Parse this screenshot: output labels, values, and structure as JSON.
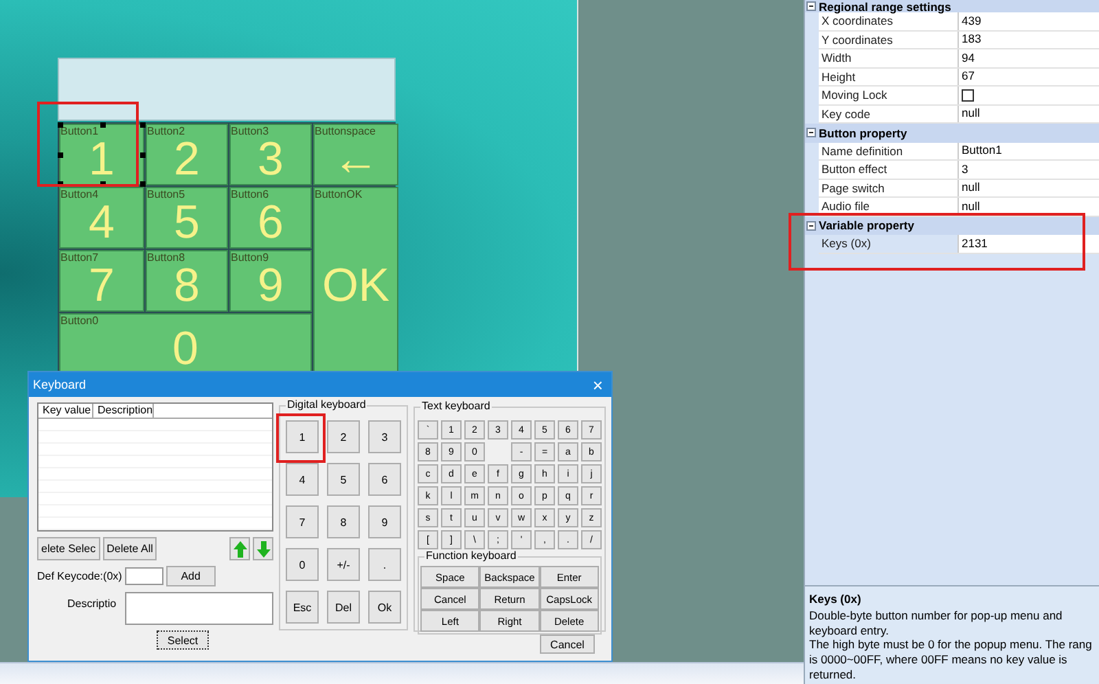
{
  "keypad": {
    "buttons": [
      {
        "name": "Button1",
        "label": "1",
        "selected": true
      },
      {
        "name": "Button2",
        "label": "2",
        "selected": false
      },
      {
        "name": "Button3",
        "label": "3",
        "selected": false
      },
      {
        "name": "Buttonspace",
        "label": "←",
        "selected": false
      },
      {
        "name": "Button4",
        "label": "4",
        "selected": false
      },
      {
        "name": "Button5",
        "label": "5",
        "selected": false
      },
      {
        "name": "Button6",
        "label": "6",
        "selected": false
      },
      {
        "name": "Button7",
        "label": "7",
        "selected": false
      },
      {
        "name": "Button8",
        "label": "8",
        "selected": false
      },
      {
        "name": "Button9",
        "label": "9",
        "selected": false
      },
      {
        "name": "ButtonOK",
        "label": "OK",
        "selected": false
      },
      {
        "name": "Button0",
        "label": "0",
        "selected": false
      }
    ]
  },
  "dialog": {
    "title": "Keyboard",
    "close": "×",
    "list": {
      "columns": [
        "Key value",
        "Description"
      ]
    },
    "buttons": [
      "elete Selec",
      "Delete All"
    ],
    "keycode_label": "Def  Keycode:(0x)",
    "add": "Add",
    "description_label": "Descriptio",
    "select": "Select",
    "cancel": "Cancel",
    "digital": {
      "title": "Digital keyboard",
      "keys": [
        {
          "label": "1",
          "highlighted": true
        },
        {
          "label": "2",
          "highlighted": false
        },
        {
          "label": "3",
          "highlighted": false
        },
        {
          "label": "4",
          "highlighted": false
        },
        {
          "label": "5",
          "highlighted": false
        },
        {
          "label": "6",
          "highlighted": false
        },
        {
          "label": "7",
          "highlighted": false
        },
        {
          "label": "8",
          "highlighted": false
        },
        {
          "label": "9",
          "highlighted": false
        },
        {
          "label": "0",
          "highlighted": false
        },
        {
          "label": "+/-",
          "highlighted": false
        },
        {
          "label": ".",
          "highlighted": false
        },
        {
          "label": "Esc",
          "highlighted": false
        },
        {
          "label": "Del",
          "highlighted": false
        },
        {
          "label": "Ok",
          "highlighted": false
        }
      ]
    },
    "text": {
      "title": "Text keyboard",
      "keys": [
        {
          "kind": "key",
          "label": "`"
        },
        {
          "kind": "key",
          "label": "1"
        },
        {
          "kind": "key",
          "label": "2"
        },
        {
          "kind": "key",
          "label": "3"
        },
        {
          "kind": "key",
          "label": "4"
        },
        {
          "kind": "key",
          "label": "5"
        },
        {
          "kind": "key",
          "label": "6"
        },
        {
          "kind": "key",
          "label": "7"
        },
        {
          "kind": "key",
          "label": "8"
        },
        {
          "kind": "key",
          "label": "9"
        },
        {
          "kind": "key",
          "label": "0"
        },
        {
          "kind": "gap"
        },
        {
          "kind": "key",
          "label": "-"
        },
        {
          "kind": "key",
          "label": "="
        },
        {
          "kind": "key",
          "label": "a"
        },
        {
          "kind": "key",
          "label": "b"
        },
        {
          "kind": "key",
          "label": "c"
        },
        {
          "kind": "key",
          "label": "d"
        },
        {
          "kind": "key",
          "label": "e"
        },
        {
          "kind": "key",
          "label": "f"
        },
        {
          "kind": "key",
          "label": "g"
        },
        {
          "kind": "key",
          "label": "h"
        },
        {
          "kind": "key",
          "label": "i"
        },
        {
          "kind": "key",
          "label": "j"
        },
        {
          "kind": "key",
          "label": "k"
        },
        {
          "kind": "key",
          "label": "l"
        },
        {
          "kind": "key",
          "label": "m"
        },
        {
          "kind": "key",
          "label": "n"
        },
        {
          "kind": "key",
          "label": "o"
        },
        {
          "kind": "key",
          "label": "p"
        },
        {
          "kind": "key",
          "label": "q"
        },
        {
          "kind": "key",
          "label": "r"
        },
        {
          "kind": "key",
          "label": "s"
        },
        {
          "kind": "key",
          "label": "t"
        },
        {
          "kind": "key",
          "label": "u"
        },
        {
          "kind": "key",
          "label": "v"
        },
        {
          "kind": "key",
          "label": "w"
        },
        {
          "kind": "key",
          "label": "x"
        },
        {
          "kind": "key",
          "label": "y"
        },
        {
          "kind": "key",
          "label": "z"
        },
        {
          "kind": "key",
          "label": "["
        },
        {
          "kind": "key",
          "label": "]"
        },
        {
          "kind": "key",
          "label": "\\"
        },
        {
          "kind": "key",
          "label": ";"
        },
        {
          "kind": "key",
          "label": "'"
        },
        {
          "kind": "key",
          "label": ","
        },
        {
          "kind": "key",
          "label": "."
        },
        {
          "kind": "key",
          "label": "/"
        }
      ]
    },
    "function": {
      "title": "Function keyboard",
      "keys": [
        "Space",
        "Backspace",
        "Enter",
        "Cancel",
        "Return",
        "CapsLock",
        "Left",
        "Right",
        "Delete"
      ]
    }
  },
  "properties": {
    "sections": [
      {
        "title": "Regional range settings",
        "highlighted": false,
        "rows": [
          {
            "kind": "text",
            "name": "X coordinates",
            "value": "439"
          },
          {
            "kind": "text",
            "name": "Y coordinates",
            "value": "183"
          },
          {
            "kind": "text",
            "name": "Width",
            "value": "94"
          },
          {
            "kind": "text",
            "name": "Height",
            "value": "67"
          },
          {
            "kind": "checkbox",
            "name": "Moving Lock",
            "checked": false
          },
          {
            "kind": "text",
            "name": "Key code",
            "value": "null"
          }
        ]
      },
      {
        "title": "Button property",
        "highlighted": false,
        "rows": [
          {
            "kind": "text",
            "name": "Name definition",
            "value": "Button1"
          },
          {
            "kind": "text",
            "name": "Button effect",
            "value": "3"
          },
          {
            "kind": "text",
            "name": "Page switch",
            "value": "null"
          },
          {
            "kind": "text",
            "name": "Audio file",
            "value": "null"
          }
        ]
      },
      {
        "title": "Variable property",
        "highlighted": true,
        "rows": [
          {
            "kind": "text",
            "name": "Keys (0x)",
            "value": "2131"
          }
        ]
      }
    ],
    "help": {
      "title": "Keys (0x)",
      "text": "Double-byte button number for pop-up menu and keyboard entry.\nThe high byte must be 0 for the popup menu. The rang\nis 0000~00FF, where 00FF means no key value is returned."
    }
  }
}
